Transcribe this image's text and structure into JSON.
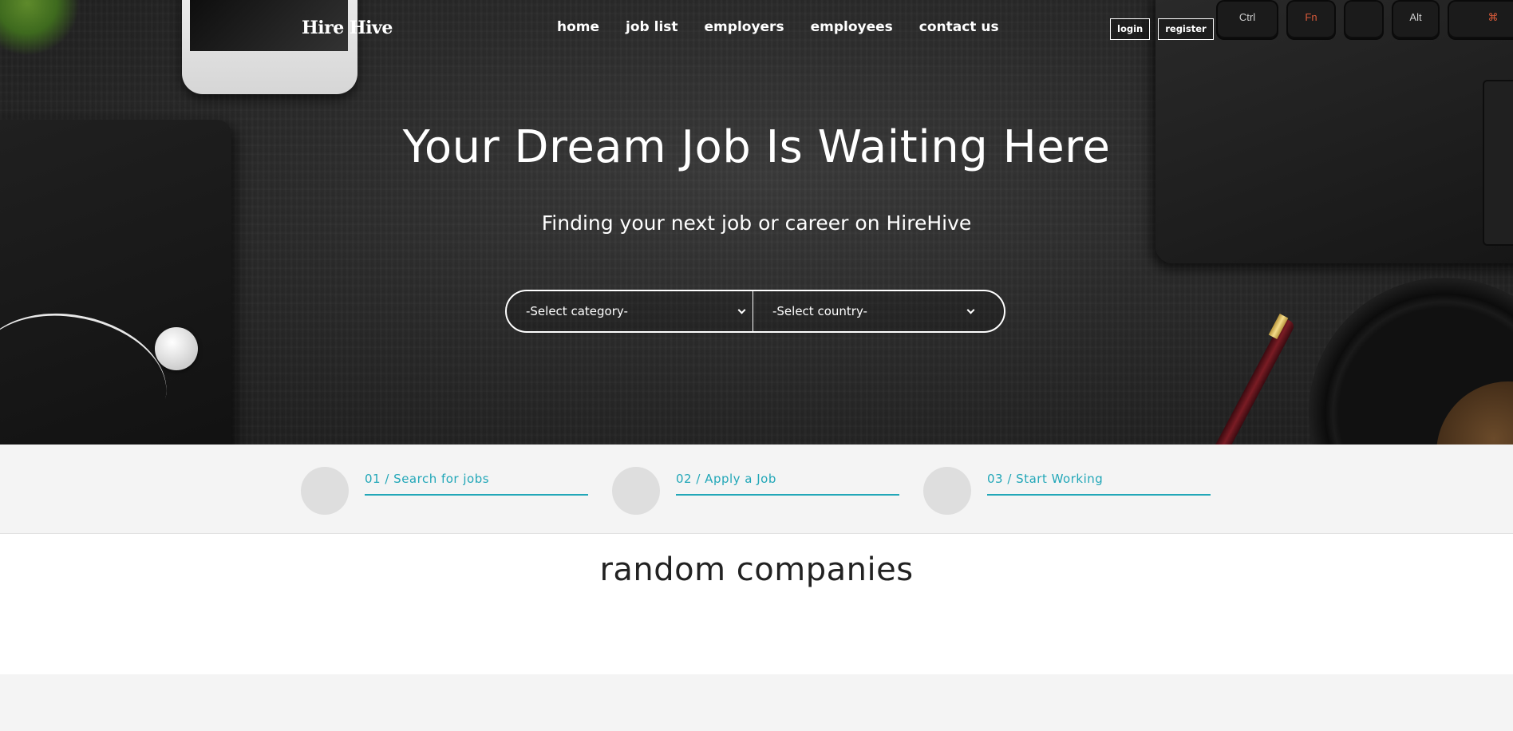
{
  "brand": {
    "logo_text": "Hire Hive"
  },
  "nav": {
    "items": [
      {
        "label": "home"
      },
      {
        "label": "job list"
      },
      {
        "label": "employers"
      },
      {
        "label": "employees"
      },
      {
        "label": "contact us"
      }
    ]
  },
  "auth": {
    "login_label": "login",
    "register_label": "register"
  },
  "hero": {
    "title": "Your Dream Job Is Waiting Here",
    "subtitle": "Finding your next job or career on HireHive",
    "category_select": {
      "selected": "-Select category-"
    },
    "country_select": {
      "selected": "-Select country-"
    }
  },
  "background_keys": [
    "Ctrl",
    "Fn",
    "",
    "Alt",
    "⌘"
  ],
  "steps": [
    {
      "label": "01 / Search for jobs"
    },
    {
      "label": "02 / Apply a Job"
    },
    {
      "label": "03 / Start Working"
    }
  ],
  "companies": {
    "heading": "random companies"
  },
  "colors": {
    "accent": "#22a7b8",
    "hero_bg": "#2b2b2b",
    "section_bg": "#f4f4f4"
  }
}
